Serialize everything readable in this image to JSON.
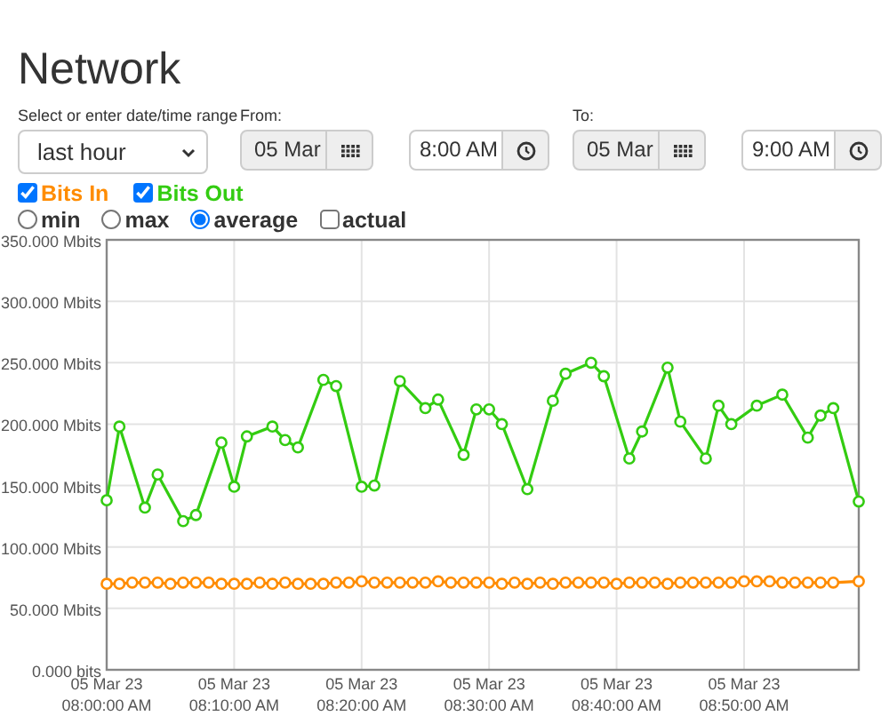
{
  "title": "Network",
  "range": {
    "label": "Select or enter date/time range",
    "value": "last hour"
  },
  "from": {
    "label": "From:",
    "date": "05 Mar",
    "time": "8:00 AM"
  },
  "to": {
    "label": "To:",
    "date": "05 Mar",
    "time": "9:00 AM"
  },
  "series_toggles": [
    {
      "checked": true
    },
    {
      "checked": true
    }
  ],
  "options": [
    {
      "kind": "radio",
      "label": "min",
      "selected": false
    },
    {
      "kind": "radio",
      "label": "max",
      "selected": false
    },
    {
      "kind": "radio",
      "label": "average",
      "selected": true
    },
    {
      "kind": "checkbox",
      "label": "actual",
      "checked": false
    }
  ],
  "chart_data": {
    "type": "line",
    "ylim": [
      0,
      350
    ],
    "grid": true,
    "yticks": [
      {
        "value": 0,
        "label": "0.000 bits"
      },
      {
        "value": 50,
        "label": "50.000 Mbits"
      },
      {
        "value": 100,
        "label": "100.000 Mbits"
      },
      {
        "value": 150,
        "label": "150.000 Mbits"
      },
      {
        "value": 200,
        "label": "200.000 Mbits"
      },
      {
        "value": 250,
        "label": "250.000 Mbits"
      },
      {
        "value": 300,
        "label": "300.000 Mbits"
      },
      {
        "value": 350,
        "label": "350.000 Mbits"
      }
    ],
    "categories": [
      "05 Mar 23\n08:00:00 AM",
      null,
      null,
      null,
      null,
      null,
      null,
      null,
      null,
      null,
      "05 Mar 23\n08:10:00 AM",
      null,
      null,
      null,
      null,
      null,
      null,
      null,
      null,
      null,
      "05 Mar 23\n08:20:00 AM",
      null,
      null,
      null,
      null,
      null,
      null,
      null,
      null,
      null,
      "05 Mar 23\n08:30:00 AM",
      null,
      null,
      null,
      null,
      null,
      null,
      null,
      null,
      null,
      "05 Mar 23\n08:40:00 AM",
      null,
      null,
      null,
      null,
      null,
      null,
      null,
      null,
      null,
      "05 Mar 23\n08:50:00 AM",
      null,
      null,
      null,
      null,
      null,
      null,
      null,
      null,
      null
    ],
    "series": [
      {
        "name": "Bits In",
        "color": "#ff8c00",
        "marker": "circle",
        "values": [
          70,
          70,
          71,
          71,
          71,
          70,
          71,
          71,
          71,
          70,
          70,
          70,
          71,
          70,
          71,
          70,
          70,
          70,
          71,
          71,
          72,
          71,
          71,
          71,
          71,
          71,
          72,
          71,
          71,
          71,
          71,
          70,
          71,
          70,
          71,
          70,
          71,
          71,
          71,
          71,
          70,
          71,
          71,
          71,
          70,
          71,
          71,
          71,
          71,
          71,
          72,
          72,
          72,
          71,
          71,
          71,
          71,
          71,
          null,
          72
        ]
      },
      {
        "name": "Bits Out",
        "color": "#33cc11",
        "marker": "circle",
        "values": [
          138,
          198,
          null,
          132,
          159,
          null,
          121,
          126,
          null,
          185,
          149,
          190,
          null,
          198,
          187,
          181,
          null,
          236,
          231,
          null,
          149,
          150,
          null,
          235,
          null,
          213,
          220,
          null,
          175,
          212,
          212,
          200,
          null,
          147,
          null,
          219,
          241,
          null,
          250,
          239,
          null,
          172,
          194,
          null,
          246,
          202,
          null,
          172,
          215,
          200,
          null,
          215,
          null,
          224,
          null,
          189,
          207,
          213,
          null,
          137
        ]
      }
    ]
  }
}
